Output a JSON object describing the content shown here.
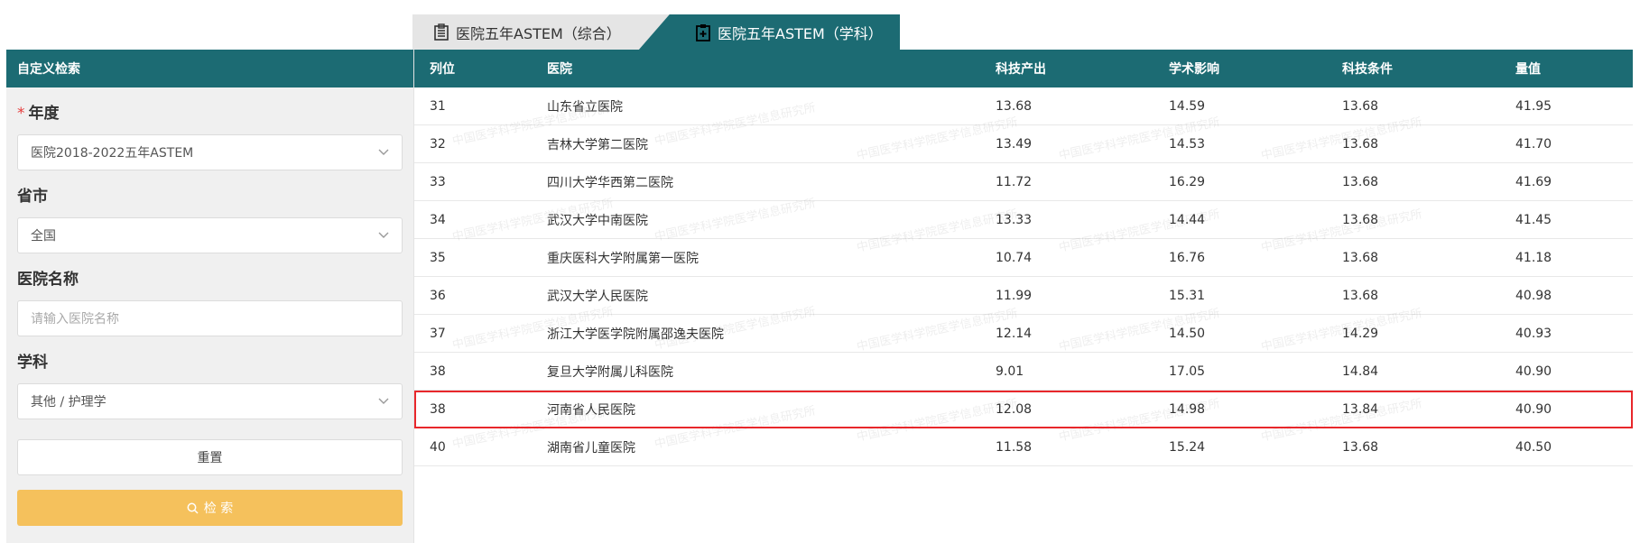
{
  "tabs": [
    {
      "label": "医院五年ASTEM（综合）",
      "icon": "building-icon"
    },
    {
      "label": "医院五年ASTEM（学科）",
      "icon": "clipboard-icon"
    }
  ],
  "sidebar": {
    "title": "自定义检索",
    "year": {
      "label": "年度",
      "required_mark": "*",
      "value": "医院2018-2022五年ASTEM"
    },
    "province": {
      "label": "省市",
      "value": "全国"
    },
    "hospital": {
      "label": "医院名称",
      "placeholder": "请输入医院名称"
    },
    "discipline": {
      "label": "学科",
      "value": "其他 / 护理学"
    },
    "reset_label": "重置",
    "search_label": "检 索"
  },
  "table": {
    "columns": [
      "列位",
      "医院",
      "科技产出",
      "学术影响",
      "科技条件",
      "量值"
    ],
    "rows": [
      [
        "31",
        "山东省立医院",
        "13.68",
        "14.59",
        "13.68",
        "41.95"
      ],
      [
        "32",
        "吉林大学第二医院",
        "13.49",
        "14.53",
        "13.68",
        "41.70"
      ],
      [
        "33",
        "四川大学华西第二医院",
        "11.72",
        "16.29",
        "13.68",
        "41.69"
      ],
      [
        "34",
        "武汉大学中南医院",
        "13.33",
        "14.44",
        "13.68",
        "41.45"
      ],
      [
        "35",
        "重庆医科大学附属第一医院",
        "10.74",
        "16.76",
        "13.68",
        "41.18"
      ],
      [
        "36",
        "武汉大学人民医院",
        "11.99",
        "15.31",
        "13.68",
        "40.98"
      ],
      [
        "37",
        "浙江大学医学院附属邵逸夫医院",
        "12.14",
        "14.50",
        "14.29",
        "40.93"
      ],
      [
        "38",
        "复旦大学附属儿科医院",
        "9.01",
        "17.05",
        "14.84",
        "40.90"
      ],
      [
        "38",
        "河南省人民医院",
        "12.08",
        "14.98",
        "13.84",
        "40.90"
      ],
      [
        "40",
        "湖南省儿童医院",
        "11.58",
        "15.24",
        "13.68",
        "40.50"
      ]
    ],
    "highlighted_row_index": 8
  },
  "watermark": "中国医学科学院医学信息研究所",
  "colors": {
    "header": "#1c6b73",
    "search_button": "#f5c15c",
    "highlight": "#e8272b"
  }
}
